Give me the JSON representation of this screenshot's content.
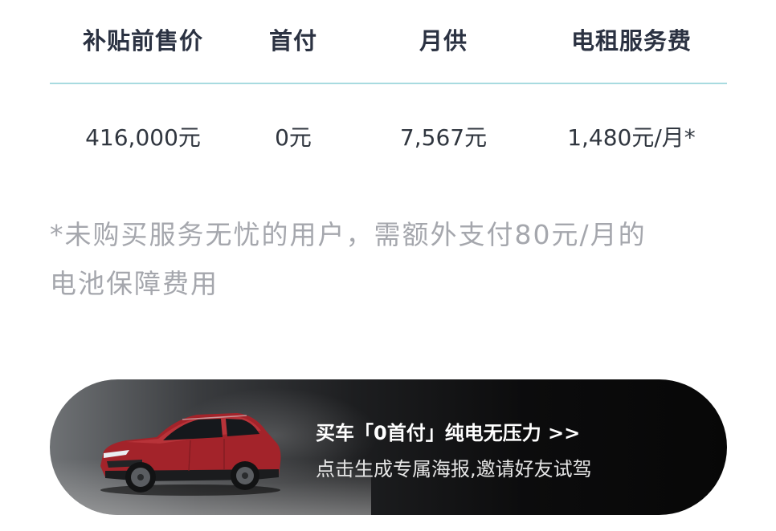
{
  "price_table": {
    "headers": [
      "补贴前售价",
      "首付",
      "月供",
      "电租服务费"
    ],
    "values": [
      "416,000元",
      "0元",
      "7,567元",
      "1,480元/月*"
    ]
  },
  "note": {
    "line1": "*未购买服务无忧的用户，需额外支付80元/月的",
    "line2": "电池保障费用"
  },
  "banner": {
    "title": "买车「0首付」纯电无压力 >>",
    "subtitle": "点击生成专属海报,邀请好友试驾"
  },
  "colors": {
    "header_text": "#2b3242",
    "divider": "#a8dbe0",
    "note_text": "#a5a7ad",
    "car_body": "#a3232a"
  }
}
